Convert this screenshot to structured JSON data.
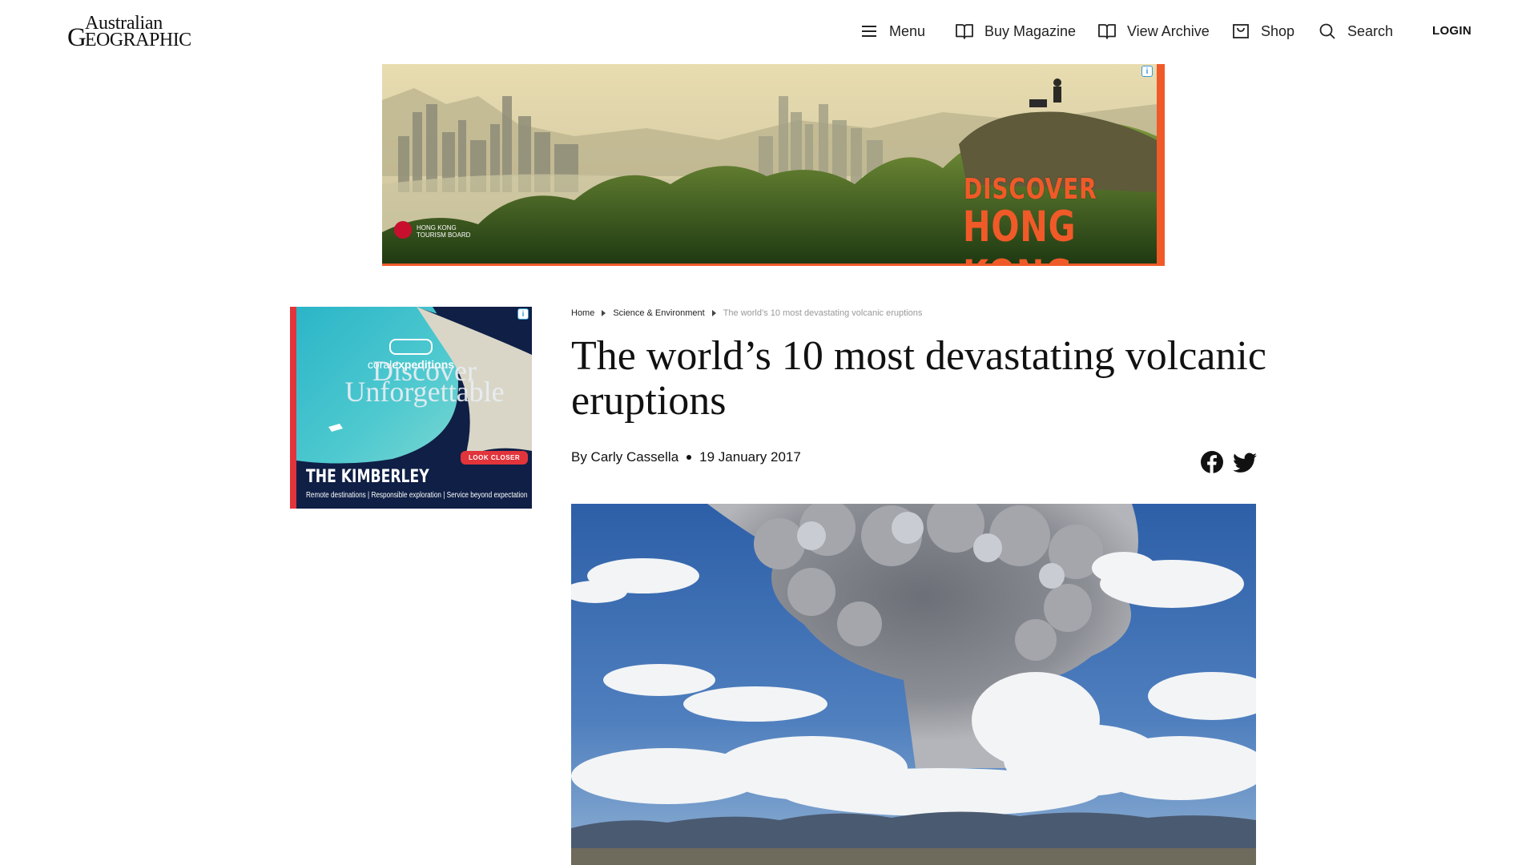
{
  "header": {
    "logo_line1": "Australian",
    "logo_line2_big": "G",
    "logo_line2_rest": "EOGRAPHIC",
    "nav": {
      "menu": "Menu",
      "buy_magazine": "Buy Magazine",
      "view_archive": "View Archive",
      "shop": "Shop",
      "search": "Search",
      "login": "LOGIN"
    }
  },
  "top_ad": {
    "headline_small": "DISCOVER",
    "headline_big": "HONG KONG",
    "board_line1": "HONG KONG",
    "board_line2": "TOURISM BOARD",
    "adchoice_icon": "adchoices-icon"
  },
  "side_ad": {
    "brand_light": "coral",
    "brand_bold": "expeditions",
    "headline_line1": "Discover",
    "headline_line2": "Unforgettable",
    "cta": "LOOK CLOSER",
    "destination": "THE KIMBERLEY",
    "tagline": "Remote destinations | Responsible exploration | Service beyond expectation",
    "adchoice_icon": "adchoices-icon"
  },
  "article": {
    "breadcrumb": {
      "home": "Home",
      "section": "Science & Environment",
      "current": "The world’s 10 most devastating volcanic eruptions"
    },
    "title": "The world’s 10 most devastating volcanic eruptions",
    "author": "By Carly Cassella",
    "date": "19 January 2017",
    "share_icons": [
      "facebook-icon",
      "twitter-icon"
    ]
  },
  "colors": {
    "ad_accent": "#f05a28",
    "side_ad_bg": "#0f1f45",
    "side_ad_red": "#e2343b",
    "adchoice_blue": "#3a9ad9"
  }
}
